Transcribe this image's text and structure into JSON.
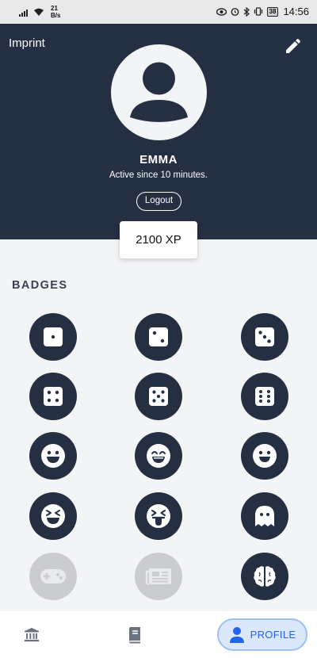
{
  "status_bar": {
    "net_speed_value": "21",
    "net_speed_unit": "B/s",
    "battery": "38",
    "time": "14:56"
  },
  "header": {
    "imprint_label": "Imprint",
    "user_name": "EMMA",
    "active_since": "Active since 10 minutes.",
    "logout_label": "Logout",
    "background_color": "#242f42"
  },
  "xp": {
    "value": "2100 XP"
  },
  "badges": {
    "title": "BADGES",
    "items": [
      {
        "icon": "dice-one-icon",
        "locked": false
      },
      {
        "icon": "dice-two-icon",
        "locked": false
      },
      {
        "icon": "dice-three-icon",
        "locked": false
      },
      {
        "icon": "dice-four-icon",
        "locked": false
      },
      {
        "icon": "dice-five-icon",
        "locked": false
      },
      {
        "icon": "dice-six-icon",
        "locked": false
      },
      {
        "icon": "grin-icon",
        "locked": false
      },
      {
        "icon": "laugh-icon",
        "locked": false
      },
      {
        "icon": "smile-icon",
        "locked": false
      },
      {
        "icon": "squint-laugh-icon",
        "locked": false
      },
      {
        "icon": "tongue-wink-icon",
        "locked": false
      },
      {
        "icon": "ghost-icon",
        "locked": false
      },
      {
        "icon": "gamepad-icon",
        "locked": true
      },
      {
        "icon": "newspaper-icon",
        "locked": true
      },
      {
        "icon": "brain-icon",
        "locked": false
      }
    ]
  },
  "bottom_nav": {
    "home_icon": "bank-icon",
    "book_icon": "book-icon",
    "profile_label": "PROFILE",
    "active_color": "#2563eb"
  }
}
